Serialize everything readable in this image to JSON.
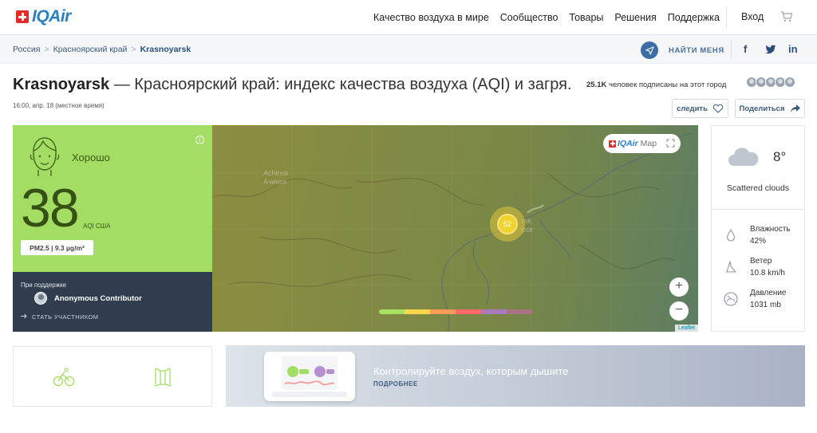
{
  "header": {
    "logo_text": "IQAir",
    "nav": [
      "Качество воздуха в мире",
      "Сообщество",
      "Товары",
      "Решения",
      "Поддержка"
    ],
    "login": "Вход"
  },
  "breadcrumb": {
    "items": [
      "Россия",
      "Красноярский край",
      "Krasnoyarsk"
    ],
    "separator": ">"
  },
  "find_me": "НАЙТИ МЕНЯ",
  "page": {
    "city": "Krasnoyarsk",
    "title_rest": " — Красноярский край: индекс качества воздуха (AQI) и загря...",
    "time": "16:00, апр. 18  (местное время)",
    "followers_count": "25.1K",
    "followers_text": " человек подписаны на этот город",
    "follow_label": "следить",
    "share_label": "Поделиться"
  },
  "aqi": {
    "status": "Хорошо",
    "value": "38",
    "unit": "AQI США",
    "pollutant": "PM2.5 | 9.3 µg/m³",
    "color": "#a4dd63",
    "support_label": "При поддержке",
    "contributor": "Anonymous Contributor",
    "join": "СТАТЬ УЧАСТНИКОМ"
  },
  "map": {
    "brand": "IQAir",
    "brand_suffix": "Map",
    "marker_value": "52",
    "city_label_1a": "Achinsk",
    "city_label_1b": "Ачинск",
    "city_label_2a": "rsk",
    "city_label_2b": "рск",
    "zoom_in": "+",
    "zoom_out": "−",
    "attribution": "Leaflet",
    "scale_colors": [
      "#a8e05f",
      "#fdd64b",
      "#ff9b57",
      "#fe6a69",
      "#a97abc",
      "#a87383"
    ]
  },
  "weather": {
    "temperature": "8°",
    "condition": "Scattered clouds",
    "humidity_label": "Влажность",
    "humidity": "42%",
    "wind_label": "Ветер",
    "wind": "10.8 km/h",
    "pressure_label": "Давление",
    "pressure": "1031 mb"
  },
  "banner": {
    "headline": "Контролируйте воздух, которым дышите",
    "more": "ПОДРОБНЕЕ"
  }
}
